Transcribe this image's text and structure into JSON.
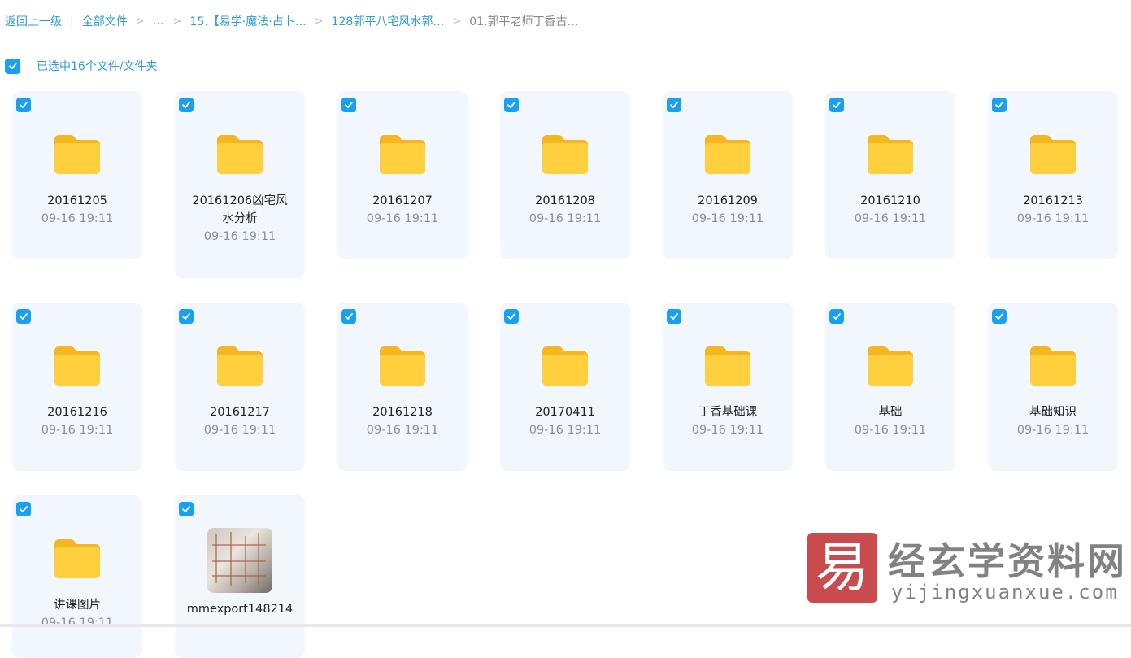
{
  "breadcrumb": {
    "back": "返回上一级",
    "all_files": "全部文件",
    "ellipsis": "…",
    "items": [
      "15.【易学·魔法·占卜…",
      "128郭平八宅风水郭…"
    ],
    "current": "01.郭平老师丁香古…"
  },
  "selection": {
    "label": "已选中16个文件/文件夹",
    "checked": true
  },
  "files": [
    {
      "name": "20161205",
      "time": "09-16 19:11",
      "type": "folder"
    },
    {
      "name": "20161206凶宅风水分析",
      "time": "09-16 19:11",
      "type": "folder"
    },
    {
      "name": "20161207",
      "time": "09-16 19:11",
      "type": "folder"
    },
    {
      "name": "20161208",
      "time": "09-16 19:11",
      "type": "folder"
    },
    {
      "name": "20161209",
      "time": "09-16 19:11",
      "type": "folder"
    },
    {
      "name": "20161210",
      "time": "09-16 19:11",
      "type": "folder"
    },
    {
      "name": "20161213",
      "time": "09-16 19:11",
      "type": "folder"
    },
    {
      "name": "20161216",
      "time": "09-16 19:11",
      "type": "folder"
    },
    {
      "name": "20161217",
      "time": "09-16 19:11",
      "type": "folder"
    },
    {
      "name": "20161218",
      "time": "09-16 19:11",
      "type": "folder"
    },
    {
      "name": "20170411",
      "time": "09-16 19:11",
      "type": "folder"
    },
    {
      "name": "丁香基础课",
      "time": "09-16 19:11",
      "type": "folder"
    },
    {
      "name": "基础",
      "time": "09-16 19:11",
      "type": "folder"
    },
    {
      "name": "基础知识",
      "time": "09-16 19:11",
      "type": "folder"
    },
    {
      "name": "讲课图片",
      "time": "09-16 19:11",
      "type": "folder"
    },
    {
      "name": "mmexport148214",
      "time": "",
      "type": "image"
    }
  ],
  "watermark": {
    "logo_char": "易",
    "cn": "经玄学资料网",
    "en": "yijingxuanxue.com"
  },
  "colors": {
    "accent": "#1aa0f0",
    "card_bg": "#f1f7fd",
    "folder": "#ffc93c"
  }
}
